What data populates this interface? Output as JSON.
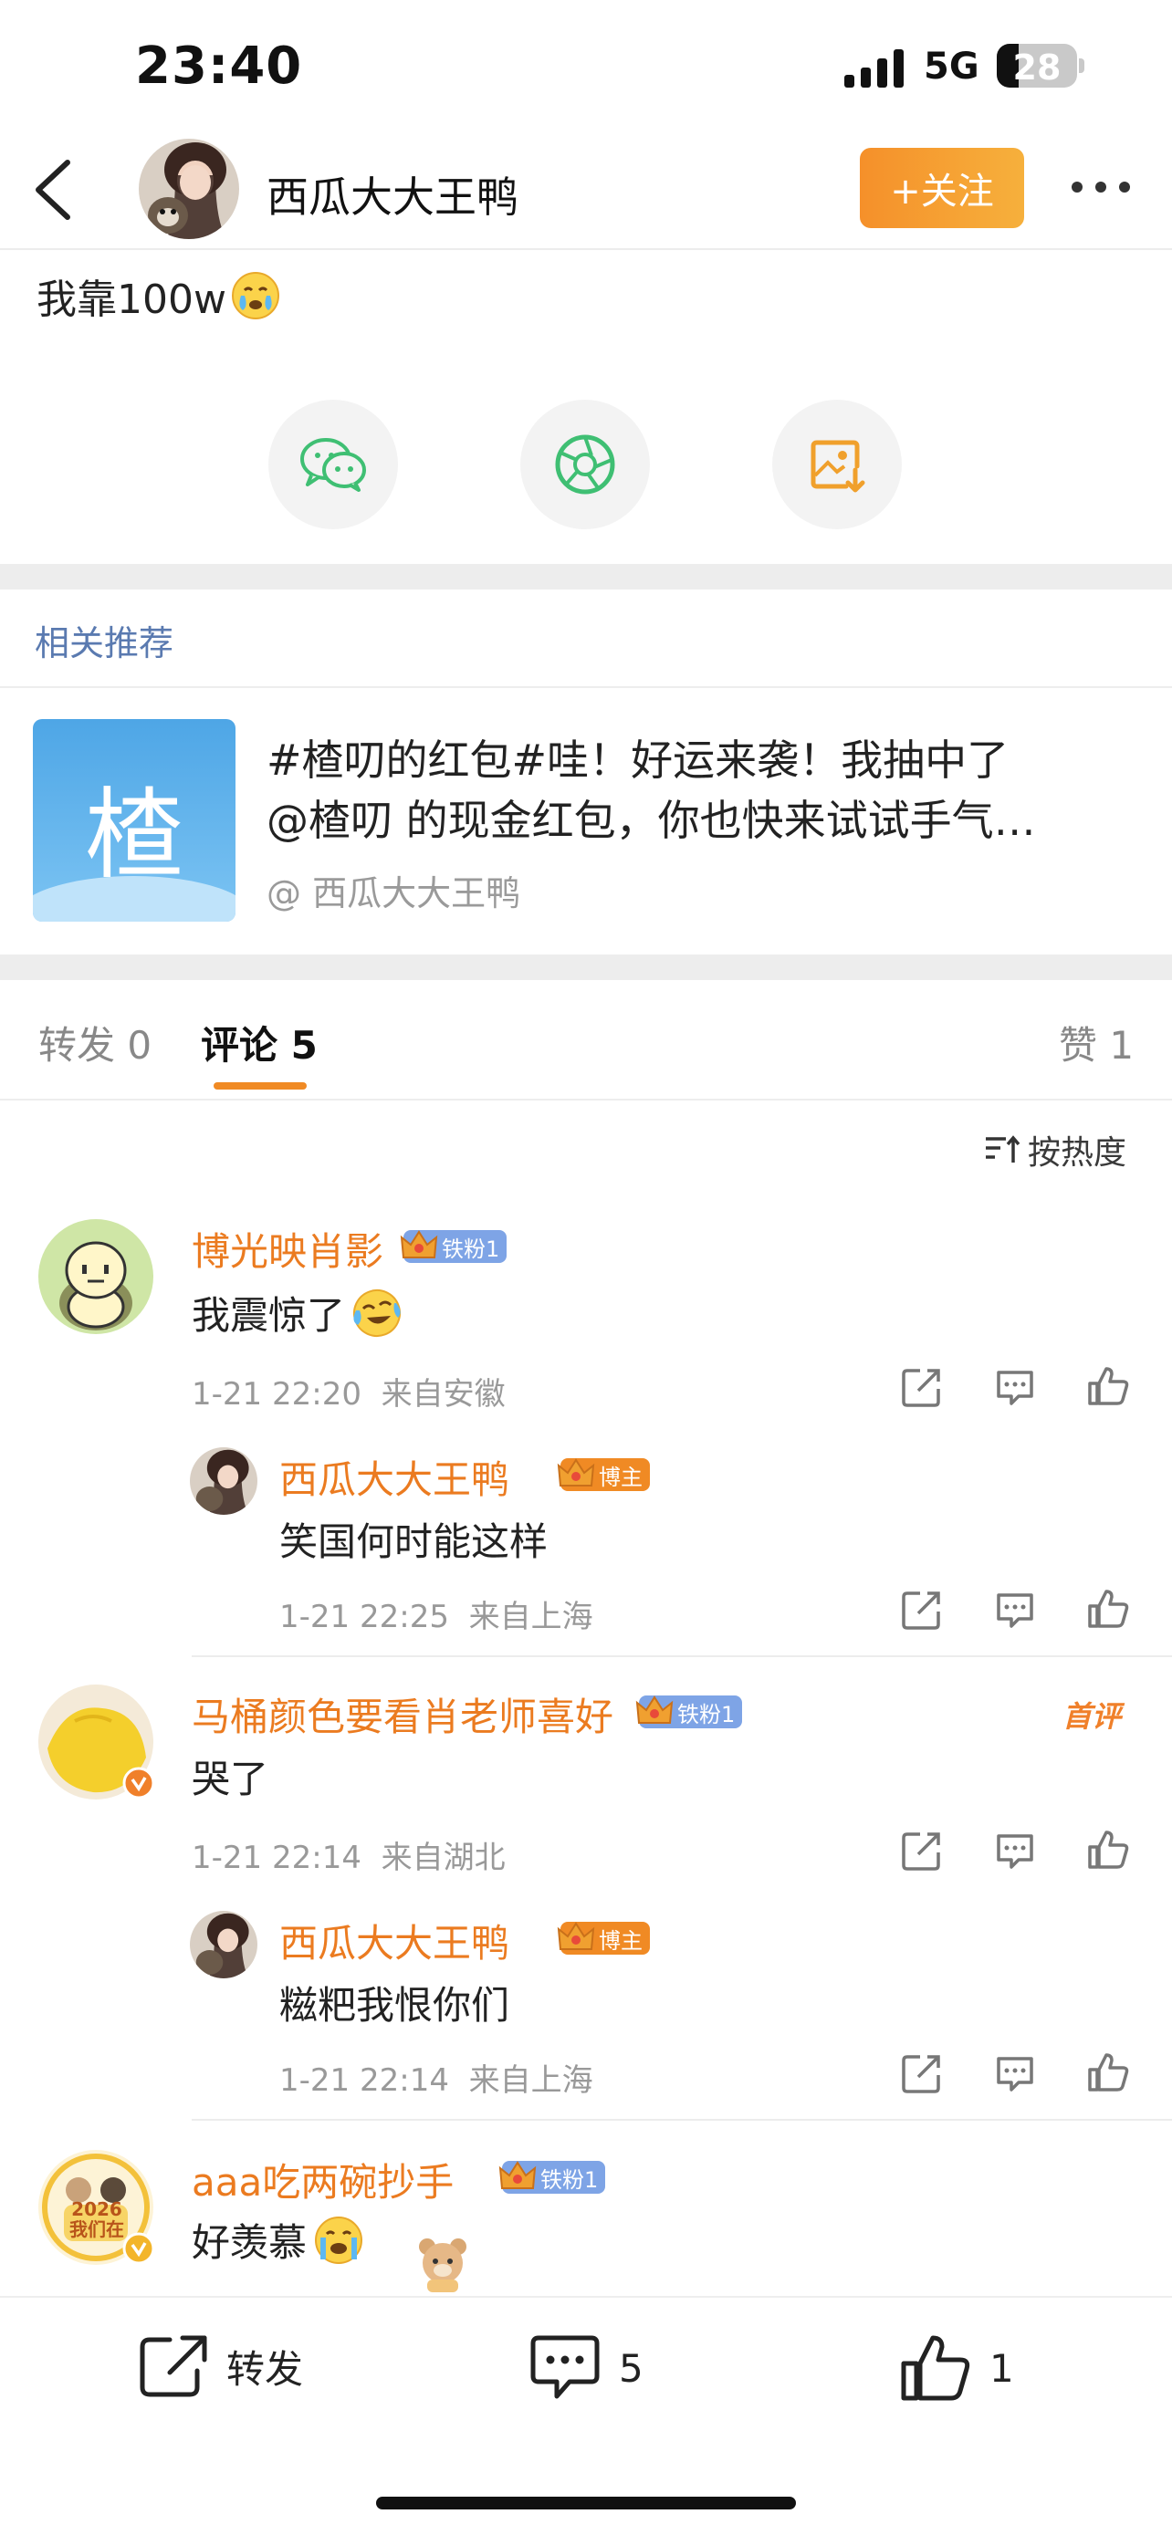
{
  "status_bar": {
    "time": "23:40",
    "network": "5G",
    "battery": "28"
  },
  "nav": {
    "username": "西瓜大大王鸭",
    "follow_label": "+关注"
  },
  "post": {
    "text": "我靠100w"
  },
  "related": {
    "title": "相关推荐",
    "card_char": "楂",
    "line1": "#楂叨的红包#哇！好运来袭！我抽中了",
    "line2": "@楂叨 的现金红包，你也快来试试手气…",
    "author": "@ 西瓜大大王鸭"
  },
  "tabs": {
    "repost_label": "转发",
    "repost_count": "0",
    "comments_label": "评论",
    "comments_count": "5",
    "likes_label": "赞",
    "likes_count": "1"
  },
  "sort_label": "按热度",
  "comments": [
    {
      "name": "博光映肖影",
      "badge": "铁粉1",
      "text": "我震惊了",
      "time": "1-21 22:20",
      "location": "来自安徽",
      "reply": {
        "name": "西瓜大大王鸭",
        "badge": "博主",
        "text": "笑国何时能这样",
        "time": "1-21 22:25",
        "location": "来自上海"
      }
    },
    {
      "name": "马桶颜色要看肖老师喜好",
      "badge": "铁粉1",
      "tag": "首评",
      "text": "哭了",
      "time": "1-21 22:14",
      "location": "来自湖北",
      "reply": {
        "name": "西瓜大大王鸭",
        "badge": "博主",
        "text": "糍粑我恨你们",
        "time": "1-21 22:14",
        "location": "来自上海"
      }
    },
    {
      "name": "aaa吃两碗抄手",
      "badge": "铁粉1",
      "text": "好羡慕",
      "avatar_text": "2026 我们在"
    }
  ],
  "bottom_bar": {
    "repost_label": "转发",
    "comment_count": "5",
    "like_count": "1"
  },
  "colors": {
    "accent": "#eb7b20",
    "follow_bg": "#f5902a",
    "link_blue": "#5a7ab0",
    "fan_badge": "#7ea4e6"
  }
}
